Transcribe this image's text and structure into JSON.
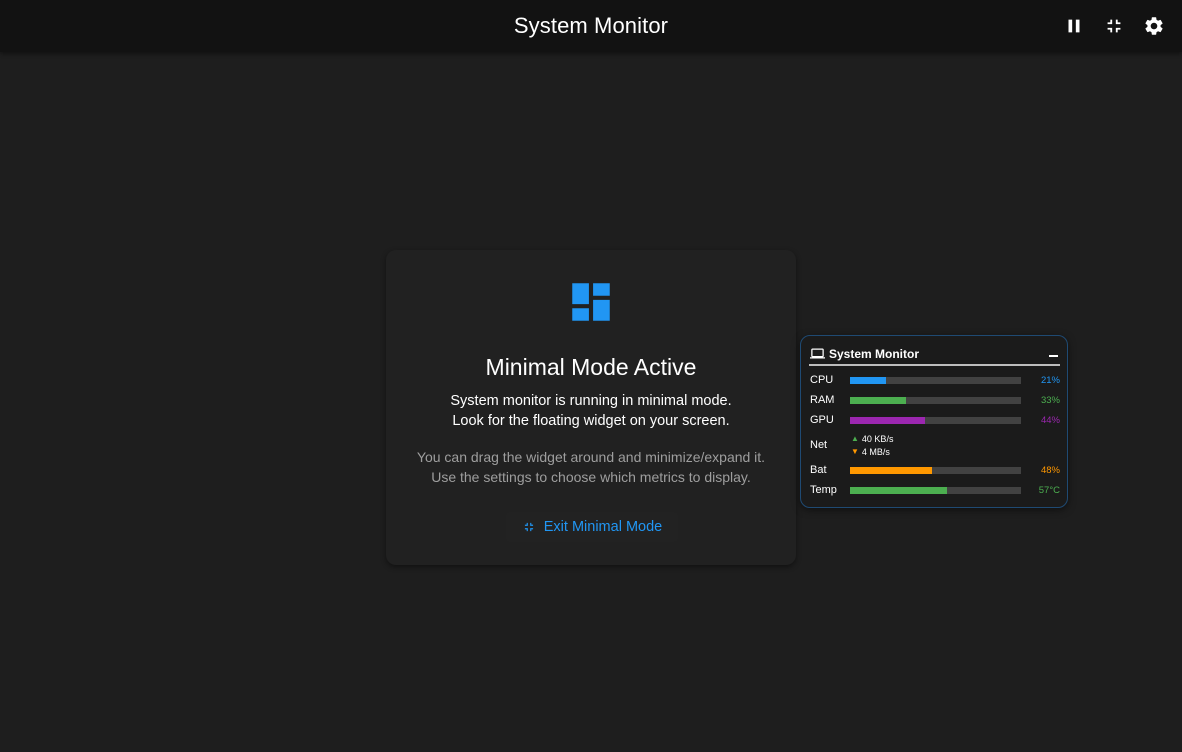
{
  "app": {
    "title": "System Monitor"
  },
  "toolbar": {
    "pause_icon": "pause-icon",
    "minimize_icon": "fullscreen-exit-icon",
    "settings_icon": "gear-icon"
  },
  "card": {
    "icon": "dashboard-icon",
    "title": "Minimal Mode Active",
    "line1": "System monitor is running in minimal mode.",
    "line2": "Look for the floating widget on your screen.",
    "hint1": "You can drag the widget around and minimize/expand it.",
    "hint2": "Use the settings to choose which metrics to display.",
    "exit_label": "Exit Minimal Mode",
    "accent_color": "#2196f3"
  },
  "widget": {
    "title": "System Monitor",
    "icon": "laptop-icon",
    "metrics": [
      {
        "label": "CPU",
        "value": "21%",
        "percent": 21,
        "color": "#2196f3"
      },
      {
        "label": "RAM",
        "value": "33%",
        "percent": 33,
        "color": "#4caf50"
      },
      {
        "label": "GPU",
        "value": "44%",
        "percent": 44,
        "color": "#9c27b0"
      },
      {
        "label": "Bat",
        "value": "48%",
        "percent": 48,
        "color": "#ff9800"
      },
      {
        "label": "Temp",
        "value": "57°C",
        "percent": 57,
        "color": "#4caf50"
      }
    ],
    "net": {
      "label": "Net",
      "upload": "40 KB/s",
      "download": "4 MB/s",
      "upload_color": "#4caf50",
      "download_color": "#ff9800"
    }
  }
}
